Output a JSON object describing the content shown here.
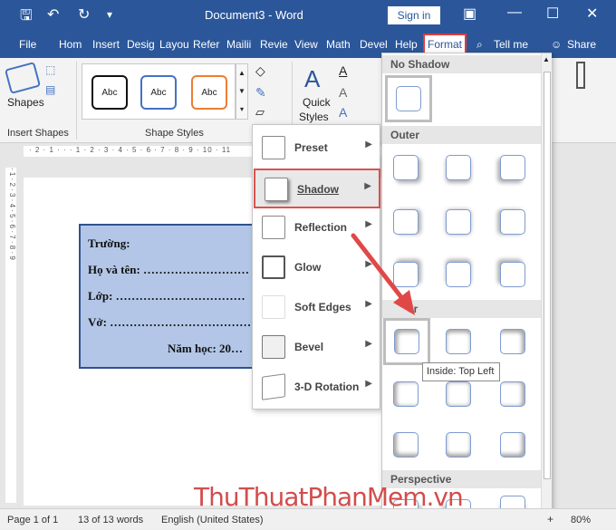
{
  "window": {
    "title": "Document3 - Word",
    "sign_in": "Sign in"
  },
  "tabs": [
    "File",
    "Hom",
    "Insert",
    "Desig",
    "Layou",
    "Refer",
    "Mailii",
    "Revie",
    "View",
    "Math",
    "Devel",
    "Help",
    "Format"
  ],
  "tell_me": "Tell me",
  "share": "Share",
  "ribbon": {
    "shapes_label": "Shapes",
    "insert_shapes": "Insert Shapes",
    "shape_styles": "Shape Styles",
    "style_boxes": [
      "Abc",
      "Abc",
      "Abc"
    ],
    "quick_styles": "Quick",
    "quick_styles_2": "Styles"
  },
  "document": {
    "lines": [
      "Trường:",
      "Họ và tên: ………………………",
      "Lớp: ……………………………",
      "Vở: ………………………………",
      "Năm học: 20…"
    ]
  },
  "effects_menu": {
    "items": [
      "Preset",
      "Shadow",
      "Reflection",
      "Glow",
      "Soft Edges",
      "Bevel",
      "3-D Rotation"
    ],
    "selected": "Shadow"
  },
  "shadow_gallery": {
    "sections": [
      "No Shadow",
      "Outer",
      "er",
      "Perspective"
    ],
    "tooltip": "Inside: Top Left"
  },
  "status": {
    "page": "Page 1 of 1",
    "words": "13 of 13 words",
    "language": "English (United States)",
    "zoom": "80%"
  },
  "watermark": "ThuThuatPhanMem.vn",
  "colors": {
    "accent": "#2b579a",
    "highlight": "#e03c3c"
  }
}
